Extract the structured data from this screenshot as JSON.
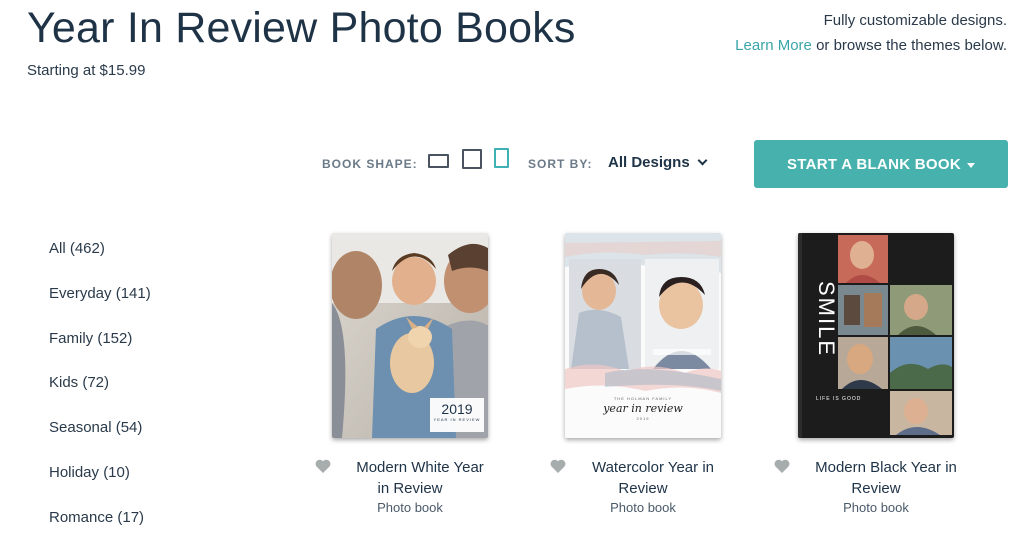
{
  "header": {
    "title": "Year In Review Photo Books",
    "price": "Starting at $15.99",
    "tagline_line1": "Fully customizable designs.",
    "learn_more": "Learn More",
    "tagline_line2": "or browse the themes below."
  },
  "controls": {
    "book_shape_label": "BOOK SHAPE:",
    "shapes": [
      "landscape",
      "square",
      "portrait"
    ],
    "active_shape": "portrait",
    "sort_label": "SORT BY:",
    "sort_value": "All Designs",
    "blank_button": "START A BLANK BOOK"
  },
  "sidebar": {
    "items": [
      {
        "label": "All (462)"
      },
      {
        "label": "Everyday (141)"
      },
      {
        "label": "Family (152)"
      },
      {
        "label": "Kids (72)"
      },
      {
        "label": "Seasonal (54)"
      },
      {
        "label": "Holiday (10)"
      },
      {
        "label": "Romance (17)"
      }
    ]
  },
  "books": [
    {
      "name_line1": "Modern White Year",
      "name_line2": "in Review",
      "type": "Photo book",
      "cover_year": "2019",
      "cover_sub": "YEAR IN REVIEW"
    },
    {
      "name_line1": "Watercolor Year in",
      "name_line2": "Review",
      "type": "Photo book",
      "cover_small": "THE HOLMAN FAMILY",
      "cover_script": "year in review",
      "cover_year": "2019"
    },
    {
      "name_line1": "Modern Black Year in",
      "name_line2": "Review",
      "type": "Photo book",
      "cover_word": "SMILE",
      "cover_sub": "LIFE IS GOOD"
    }
  ],
  "colors": {
    "accent": "#46b1ad",
    "link": "#3aa5a8",
    "title": "#1f3347",
    "heart": "#a7acad"
  }
}
